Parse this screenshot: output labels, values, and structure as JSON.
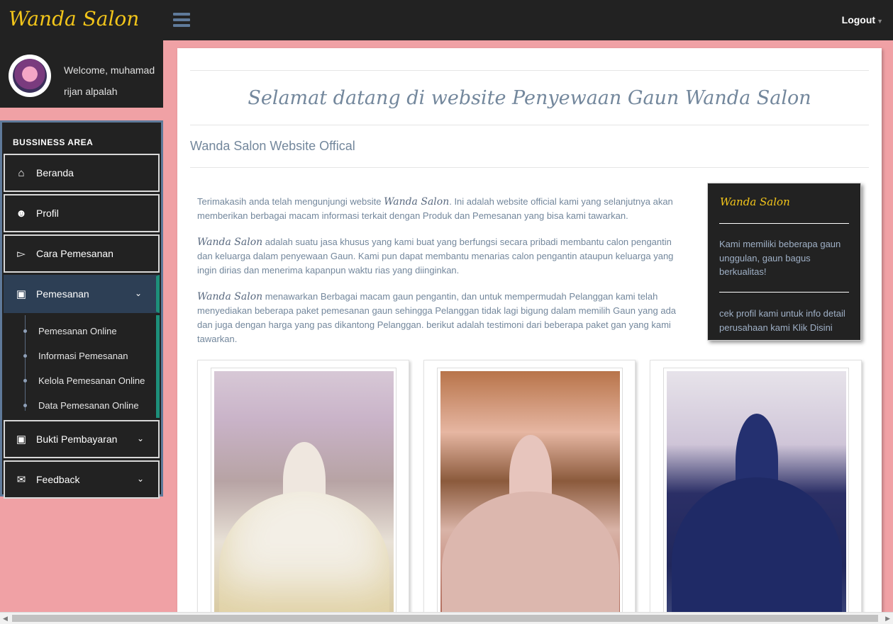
{
  "header": {
    "brand": "Wanda Salon",
    "logout_label": "Logout",
    "menu_icon": "hamburger-icon"
  },
  "user": {
    "welcome_text": "Welcome, muhamad rijan alpalah",
    "avatar_icon": "user-avatar"
  },
  "sidebar": {
    "section_title": "BUSSINESS AREA",
    "items": [
      {
        "label": "Beranda",
        "icon": "home-icon"
      },
      {
        "label": "Profil",
        "icon": "users-icon"
      },
      {
        "label": "Cara Pemesanan",
        "icon": "bullhorn-icon"
      },
      {
        "label": "Pemesanan",
        "icon": "cart-icon",
        "expanded": true
      },
      {
        "label": "Bukti Pembayaran",
        "icon": "cart-icon"
      },
      {
        "label": "Feedback",
        "icon": "envelope-icon"
      }
    ],
    "submenu": [
      "Pemesanan Online",
      "Informasi Pemesanan",
      "Kelola Pemesanan Online",
      "Data Pemesanan Online"
    ]
  },
  "main": {
    "title": "Selamat datang di website Penyewaan Gaun Wanda Salon",
    "subtitle": "Wanda Salon Website Offical",
    "p1_a": "Terimakasih anda telah mengunjungi website",
    "p1_brand": "Wanda Salon",
    "p1_b": ". Ini adalah website official kami yang selanjutnya akan memberikan berbagai macam informasi terkait dengan Produk dan Pemesanan yang bisa kami tawarkan.",
    "p2_brand": "Wanda Salon",
    "p2": "adalah suatu jasa khusus yang kami buat yang berfungsi secara pribadi membantu calon pengantin dan keluarga dalam penyewaan Gaun. Kami pun dapat membantu menarias calon pengantin ataupun keluarga yang ingin dirias dan menerima kapanpun waktu rias yang diinginkan.",
    "p3_brand": "Wanda Salon",
    "p3": "menawarkan Berbagai macam gaun pengantin, dan untuk mempermudah Pelanggan kami telah menyediakan beberapa paket pemesanan gaun sehingga Pelanggan tidak lagi bigung dalam memilih Gaun yang ada dan juga dengan harga yang pas dikantong Pelanggan. berikut adalah testimoni dari beberapa paket gan yang kami tawarkan.",
    "infobox": {
      "title": "Wanda Salon",
      "text1": "Kami memiliki beberapa gaun unggulan, gaun bagus berkualitas!",
      "text2": "cek profil kami untuk info detail perusahaan kami Klik Disini"
    }
  },
  "colors": {
    "brand_yellow": "#f2c51a",
    "background_pink": "#f0a1a5",
    "dark": "#222222",
    "active": "#2d3f55",
    "accent_teal": "#1d8f7a"
  }
}
